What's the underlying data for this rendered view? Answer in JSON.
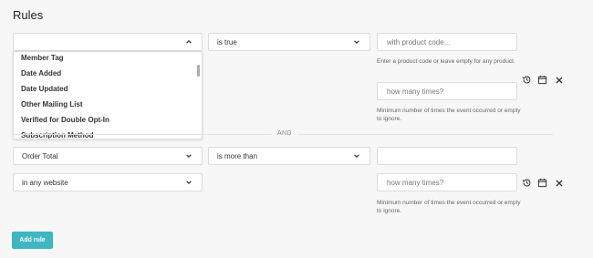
{
  "page": {
    "title": "Rules"
  },
  "rule1": {
    "field_select": "",
    "condition_select": "is true",
    "product_input_placeholder": "with product code...",
    "product_help": "Enter a product code or leave empty for any product.",
    "times_input_placeholder": "how many times?",
    "times_help": "Minimum number of times the event occurred or empty to ignore.",
    "dropdown_options": [
      "Member Tag",
      "Date Added",
      "Date Updated",
      "Other Mailing List",
      "Verified for Double Opt-In",
      "Subscription Method"
    ]
  },
  "separator": {
    "label": "AND"
  },
  "rule2": {
    "field_select": "Order Total",
    "condition_select": "is more than",
    "value_input": "",
    "website_select": "in any website",
    "times_input_placeholder": "how many times?",
    "times_help": "Minimum number of times the event occurred or empty to ignore."
  },
  "actions": {
    "add_rule_label": "Add rule"
  },
  "icons": {
    "history": "history-icon",
    "calendar": "calendar-icon",
    "close": "close-icon",
    "chevron_down": "chevron-down-icon",
    "chevron_up": "chevron-up-icon"
  },
  "colors": {
    "accent": "#3fb7c2"
  }
}
